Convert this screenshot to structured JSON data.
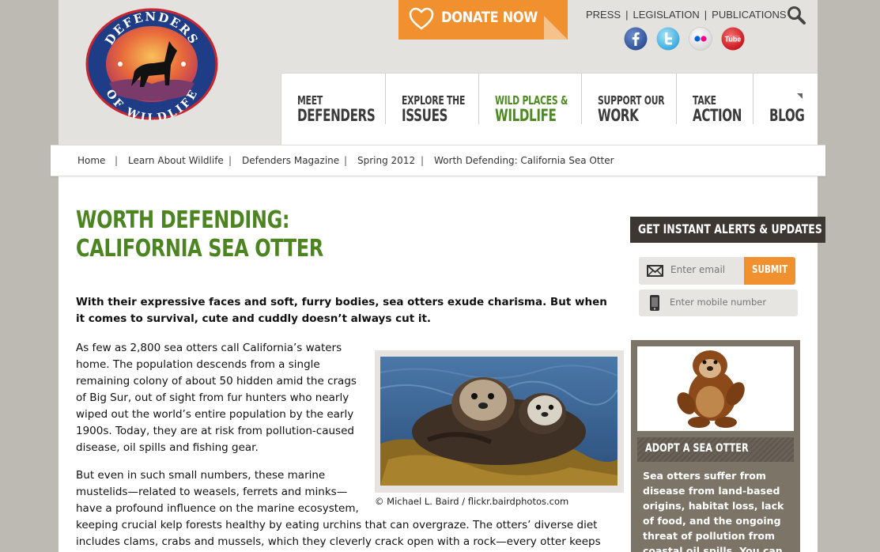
{
  "header": {
    "logo_text_top": "DEFENDERS",
    "logo_text_bottom": "OF WILDLIFE",
    "donate_label": "DONATE NOW",
    "top_links": [
      "PRESS",
      "LEGISLATION",
      "PUBLICATIONS"
    ],
    "social": [
      "facebook-icon",
      "twitter-icon",
      "flickr-icon",
      "youtube-icon"
    ],
    "youtube_label": "Tube"
  },
  "nav": [
    {
      "line1": "MEET",
      "line2": "DEFENDERS"
    },
    {
      "line1": "EXPLORE THE",
      "line2": "ISSUES"
    },
    {
      "line1": "WILD PLACES &",
      "line2": "WILDLIFE"
    },
    {
      "line1": "SUPPORT OUR",
      "line2": "WORK"
    },
    {
      "line1": "TAKE",
      "line2": "ACTION"
    },
    {
      "line1": "",
      "line2": "BLOG"
    }
  ],
  "breadcrumb": [
    "Home",
    "Learn About Wildlife",
    "Defenders Magazine",
    "Spring 2012",
    "Worth Defending: California Sea Otter"
  ],
  "article": {
    "title": "WORTH DEFENDING: CALIFORNIA SEA OTTER",
    "lede": "With their expressive faces and soft, furry bodies, sea otters exude charisma. But when it comes to survival, cute and cuddly doesn’t always cut it.",
    "para1": "As few as 2,800 sea otters call California’s waters home. The population descends from a single remaining colony of about 50 hidden amid the crags of Big Sur, out of sight from fur hunters who nearly wiped out the world’s entire population by the early 1900s. Today, they are at risk from pollution-caused disease, oil spills and fishing gear.",
    "para2a": "But even in such small numbers, these marine mustelids—related to weasels, ferrets and minks—have a profound influence on the marine ecosystem,",
    "para2b": "keeping crucial kelp forests healthy by eating urchins that can overgraze. The otters’ diverse diet includes clams, crabs and mussels, which they cleverly crack open with a rock—every otter keeps one",
    "photo_credit": "© Michael L. Baird / flickr.bairdphotos.com"
  },
  "sidebar": {
    "alerts_heading": "GET INSTANT ALERTS & UPDATES",
    "email_placeholder": "Enter email",
    "submit_label": "SUBMIT",
    "mobile_placeholder": "Enter mobile number",
    "adopt_heading": "ADOPT A SEA OTTER",
    "adopt_text": "Sea otters suffer from disease from land-based origins, habitat loss, lack of food, and the ongoing threat of pollution from coastal oil spills. You can help save"
  },
  "colors": {
    "accent_orange": "#f0902e",
    "title_green": "#4b8421",
    "nav_green": "#4e8a22"
  }
}
